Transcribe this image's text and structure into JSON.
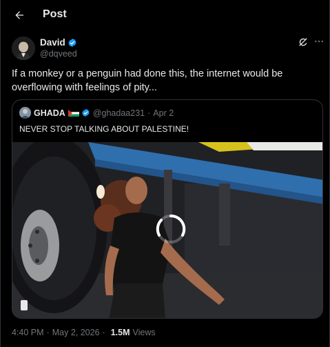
{
  "header": {
    "title": "Post"
  },
  "author": {
    "name": "David",
    "handle": "@dqveed"
  },
  "post": {
    "text": "If a monkey or a penguin had done this, the internet would be overflowing with feelings of pity..."
  },
  "quote": {
    "name": "GHADA",
    "handle": "@ghadaa231",
    "separator": "·",
    "date": "Apr 2",
    "text": "NEVER STOP TALKING ABOUT PALESTINE!"
  },
  "meta": {
    "time": "4:40 PM",
    "date": "May 2, 2026",
    "separator": "·",
    "views_count": "1.5M",
    "views_label": "Views"
  },
  "icons": {
    "back": "arrow-left-icon",
    "verified": "verified-badge-icon",
    "grok": "grok-icon",
    "more": "more-horizontal-icon",
    "loading": "loading-spinner-icon"
  },
  "colors": {
    "background": "#000000",
    "text": "#e7e9ea",
    "muted": "#71767b",
    "border": "#2f3336",
    "verified": "#1d9bf0"
  }
}
